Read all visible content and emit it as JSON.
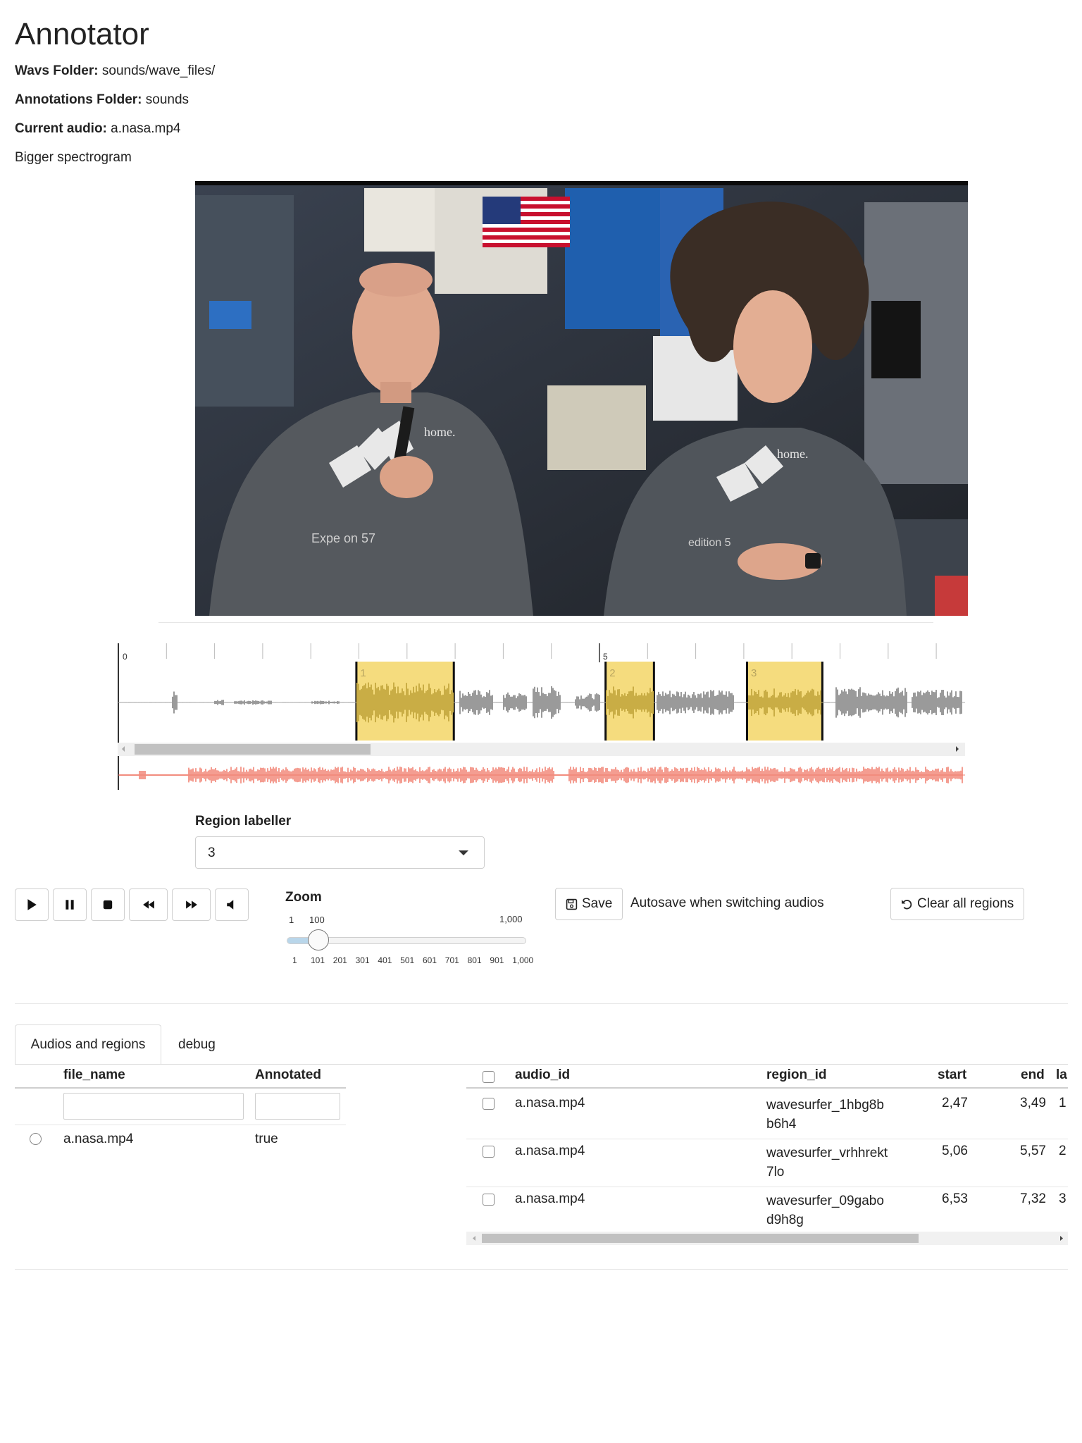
{
  "app": {
    "title": "Annotator",
    "wavs_label": "Wavs Folder:",
    "wavs_value": "sounds/wave_files/",
    "annotations_label": "Annotations Folder:",
    "annotations_value": "sounds",
    "current_label": "Current audio:",
    "current_value": "a.nasa.mp4",
    "bigger_spectrogram": "Bigger spectrogram"
  },
  "video": {
    "shirt_text_left": "home.",
    "shirt_text_right": "home.",
    "shirt_sub_left": "Expe   on 57",
    "shirt_sub_right": "edition 5"
  },
  "waveform": {
    "timeline_labels": [
      "0",
      "5"
    ],
    "regions": [
      {
        "label": "1",
        "start": 2.47,
        "end": 3.49
      },
      {
        "label": "2",
        "start": 5.06,
        "end": 5.57
      },
      {
        "label": "3",
        "start": 6.53,
        "end": 7.32
      }
    ],
    "colors": {
      "region": "#f5dc7e",
      "wave": "#9a9a9a",
      "minimap": "#f07c6c"
    }
  },
  "region_labeller": {
    "label": "Region labeller",
    "value": "3"
  },
  "transport": [
    "play-icon",
    "pause-icon",
    "stop-icon",
    "rewind-icon",
    "fast-forward-icon",
    "mute-icon"
  ],
  "zoom": {
    "label": "Zoom",
    "min": "1",
    "value": "100",
    "max": "1,000",
    "ticks": [
      "1",
      "101",
      "201",
      "301",
      "401",
      "501",
      "601",
      "701",
      "801",
      "901",
      "1,000"
    ]
  },
  "actions": {
    "save": "Save",
    "autosave": "Autosave when switching audios",
    "clear": "Clear all regions"
  },
  "tabs": [
    "Audios and regions",
    "debug"
  ],
  "audios_table": {
    "headers": [
      "file_name",
      "Annotated"
    ],
    "rows": [
      {
        "file_name": "a.nasa.mp4",
        "annotated": "true"
      }
    ]
  },
  "regions_table": {
    "headers": [
      "audio_id",
      "region_id",
      "start",
      "end",
      "lal"
    ],
    "rows": [
      {
        "audio_id": "a.nasa.mp4",
        "region_id_1": "wavesurfer_1hbg8b",
        "region_id_2": "b6h4",
        "start": "2,47",
        "end": "3,49",
        "label": "1"
      },
      {
        "audio_id": "a.nasa.mp4",
        "region_id_1": "wavesurfer_vrhhrekt",
        "region_id_2": "7lo",
        "start": "5,06",
        "end": "5,57",
        "label": "2"
      },
      {
        "audio_id": "a.nasa.mp4",
        "region_id_1": "wavesurfer_09gabo",
        "region_id_2": "d9h8g",
        "start": "6,53",
        "end": "7,32",
        "label": "3"
      }
    ]
  }
}
